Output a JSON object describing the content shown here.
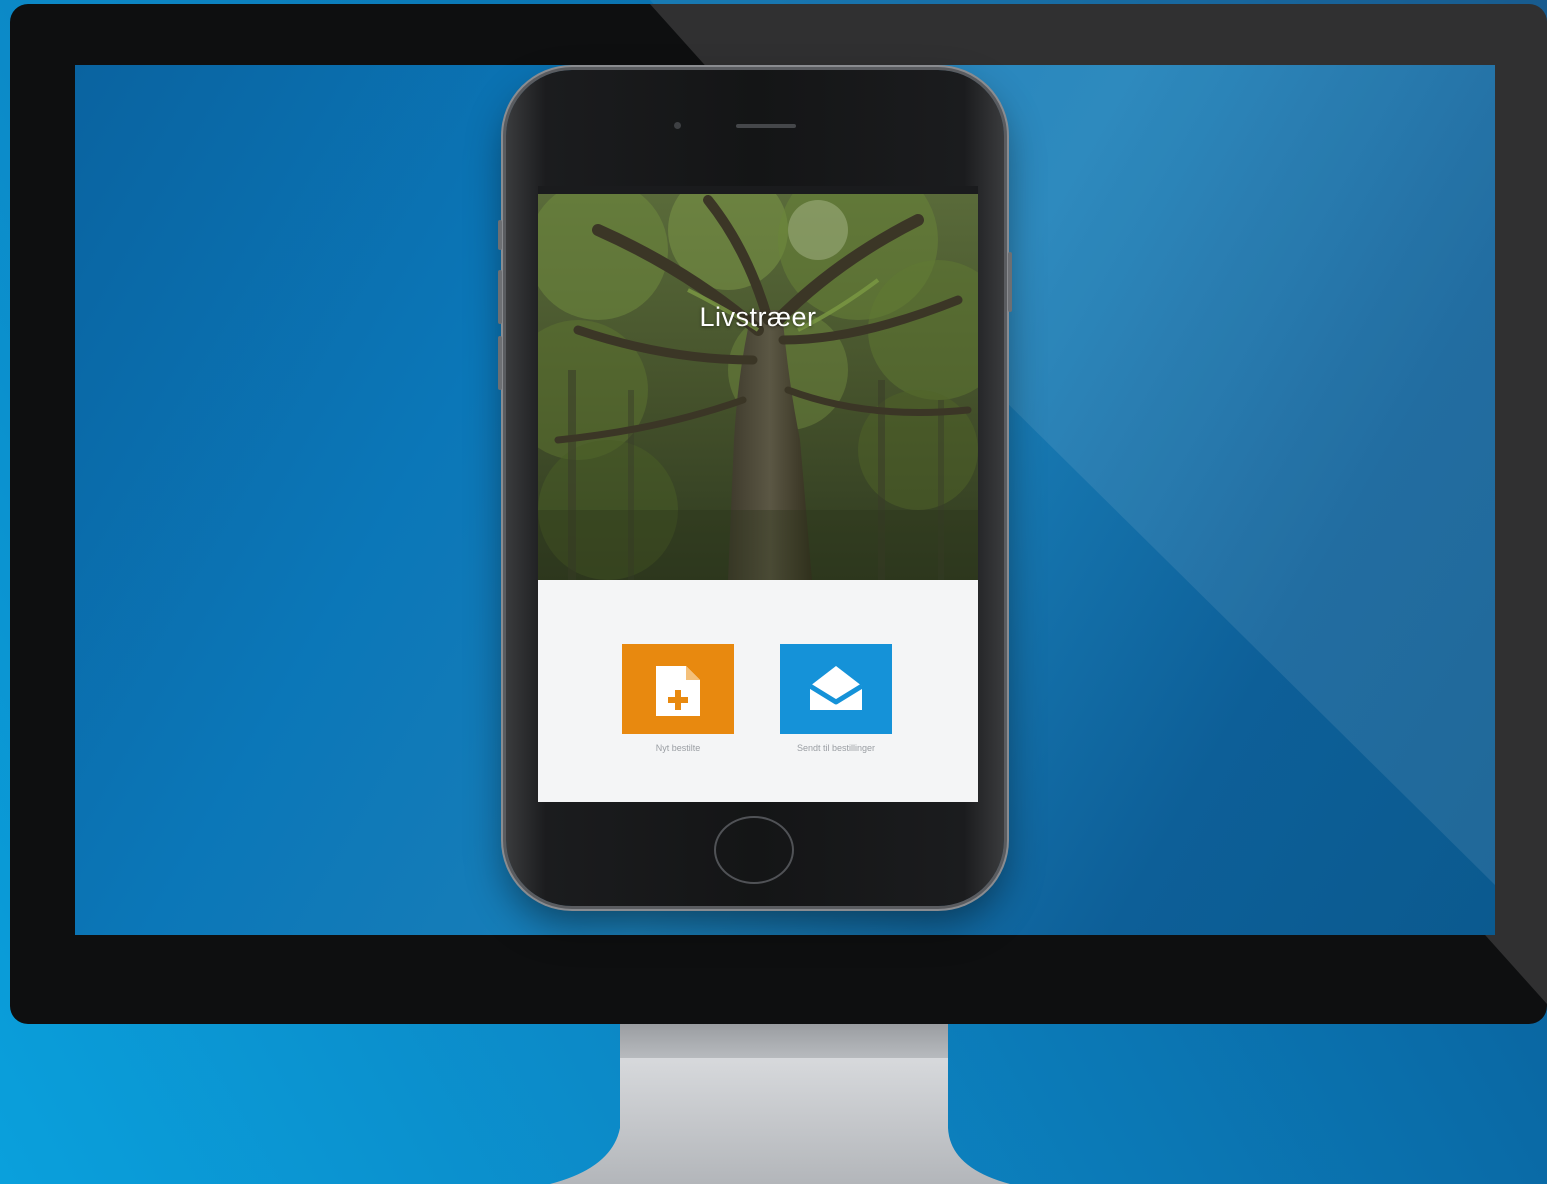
{
  "app": {
    "title": "Livstræer"
  },
  "tiles": [
    {
      "label": "Nyt bestilte",
      "icon": "new-document-icon",
      "color": "#e8890f"
    },
    {
      "label": "Sendt til bestillinger",
      "icon": "open-envelope-icon",
      "color": "#1592d8"
    }
  ],
  "colors": {
    "background": "#0c86c4",
    "monitor_bezel": "#0e0f10",
    "phone_body": "#141516",
    "app_background": "#f4f5f6"
  }
}
